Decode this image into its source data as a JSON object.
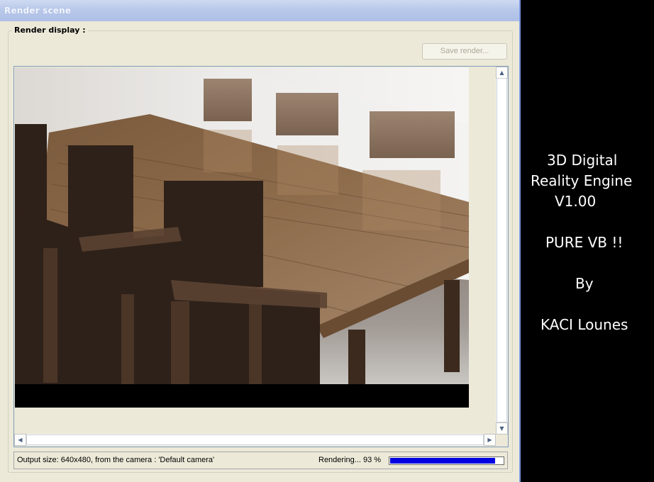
{
  "window": {
    "title": "Render scene"
  },
  "group": {
    "label": "Render display :"
  },
  "toolbar": {
    "save_label": "Save render..."
  },
  "status": {
    "output_info": "Output size: 640x480, from the camera : 'Default camera'",
    "rendering_text": "Rendering... 93 %",
    "progress": 0.93,
    "progress_color": "#0000e0"
  },
  "credits": {
    "line1": "3D Digital",
    "line2": "Reality Engine",
    "line3": "V1.00",
    "line4": "PURE VB !!",
    "line5": "By",
    "line6": "KACI Lounes"
  },
  "icons": {
    "scroll_up": "arrow-up-icon",
    "scroll_down": "arrow-down-icon",
    "scroll_left": "arrow-left-icon",
    "scroll_right": "arrow-right-icon"
  },
  "colors": {
    "window_bg": "#ece9d8",
    "titlebar": "#b9c9ea",
    "desktop_bg": "#000000"
  }
}
